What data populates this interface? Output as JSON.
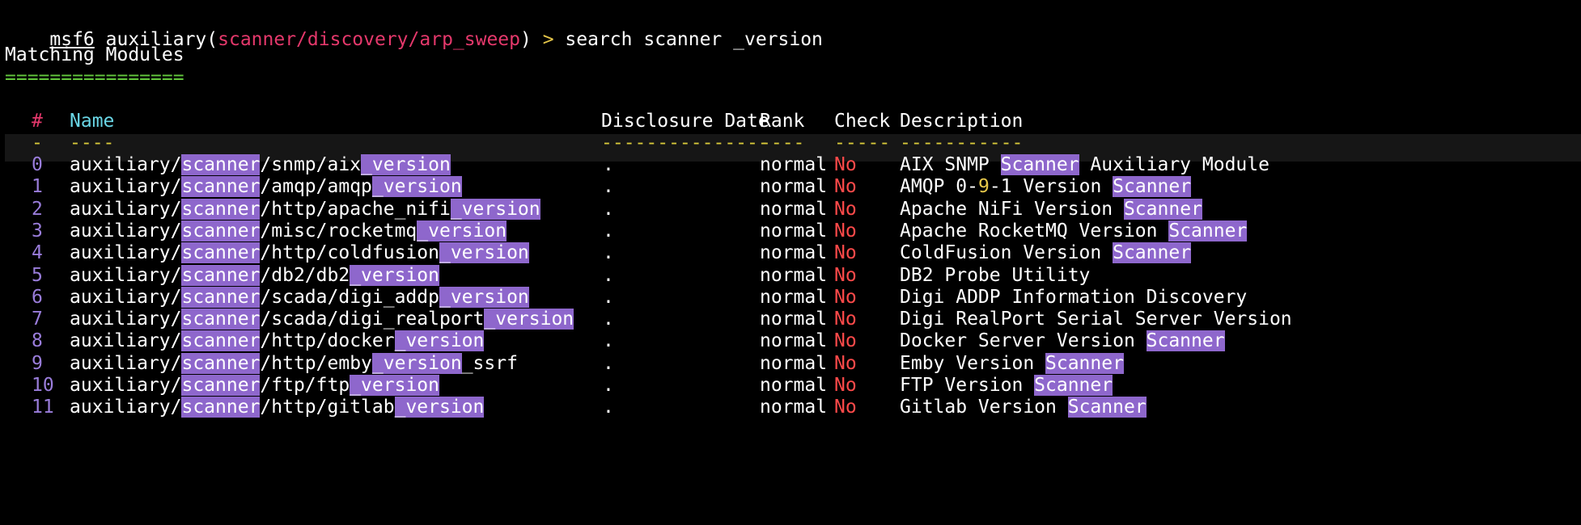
{
  "prompt": {
    "msf": "msf6",
    "keyword": "auxiliary",
    "module": "scanner/discovery/arp_sweep",
    "arrow": ">",
    "command": "search scanner _version"
  },
  "section": {
    "title": "Matching Modules",
    "underline": "================"
  },
  "table": {
    "headers": {
      "num": "#",
      "name": "Name",
      "date": "Disclosure Date",
      "rank": "Rank",
      "check": "Check",
      "desc": "Description"
    },
    "dashes": {
      "num": "-",
      "name": "----",
      "date": "---------------",
      "rank": "----",
      "check": "-----",
      "desc": "-----------"
    },
    "rows": [
      {
        "idx": "0",
        "name_pre": "auxiliary/",
        "name_hl1": "scanner",
        "name_mid": "/snmp/aix",
        "name_hl2": "_version",
        "name_post": "",
        "date": ".",
        "rank": "normal",
        "check": "No",
        "desc_pre": "AIX SNMP ",
        "desc_hl": "Scanner",
        "desc_post": " Auxiliary Module"
      },
      {
        "idx": "1",
        "name_pre": "auxiliary/",
        "name_hl1": "scanner",
        "name_mid": "/amqp/amqp",
        "name_hl2": "_version",
        "name_post": "",
        "date": ".",
        "rank": "normal",
        "check": "No",
        "desc_pre": "AMQP 0-9-1 Version ",
        "desc_hl": "Scanner",
        "desc_post": ""
      },
      {
        "idx": "2",
        "name_pre": "auxiliary/",
        "name_hl1": "scanner",
        "name_mid": "/http/apache_nifi",
        "name_hl2": "_version",
        "name_post": "",
        "date": ".",
        "rank": "normal",
        "check": "No",
        "desc_pre": "Apache NiFi Version ",
        "desc_hl": "Scanner",
        "desc_post": ""
      },
      {
        "idx": "3",
        "name_pre": "auxiliary/",
        "name_hl1": "scanner",
        "name_mid": "/misc/rocketmq",
        "name_hl2": "_version",
        "name_post": "",
        "date": ".",
        "rank": "normal",
        "check": "No",
        "desc_pre": "Apache RocketMQ Version ",
        "desc_hl": "Scanner",
        "desc_post": ""
      },
      {
        "idx": "4",
        "name_pre": "auxiliary/",
        "name_hl1": "scanner",
        "name_mid": "/http/coldfusion",
        "name_hl2": "_version",
        "name_post": "",
        "date": ".",
        "rank": "normal",
        "check": "No",
        "desc_pre": "ColdFusion Version ",
        "desc_hl": "Scanner",
        "desc_post": ""
      },
      {
        "idx": "5",
        "name_pre": "auxiliary/",
        "name_hl1": "scanner",
        "name_mid": "/db2/db2",
        "name_hl2": "_version",
        "name_post": "",
        "date": ".",
        "rank": "normal",
        "check": "No",
        "desc_pre": "DB2 Probe Utility",
        "desc_hl": "",
        "desc_post": ""
      },
      {
        "idx": "6",
        "name_pre": "auxiliary/",
        "name_hl1": "scanner",
        "name_mid": "/scada/digi_addp",
        "name_hl2": "_version",
        "name_post": "",
        "date": ".",
        "rank": "normal",
        "check": "No",
        "desc_pre": "Digi ADDP Information Discovery",
        "desc_hl": "",
        "desc_post": ""
      },
      {
        "idx": "7",
        "name_pre": "auxiliary/",
        "name_hl1": "scanner",
        "name_mid": "/scada/digi_realport",
        "name_hl2": "_version",
        "name_post": "",
        "date": ".",
        "rank": "normal",
        "check": "No",
        "desc_pre": "Digi RealPort Serial Server Version",
        "desc_hl": "",
        "desc_post": ""
      },
      {
        "idx": "8",
        "name_pre": "auxiliary/",
        "name_hl1": "scanner",
        "name_mid": "/http/docker",
        "name_hl2": "_version",
        "name_post": "",
        "date": ".",
        "rank": "normal",
        "check": "No",
        "desc_pre": "Docker Server Version ",
        "desc_hl": "Scanner",
        "desc_post": ""
      },
      {
        "idx": "9",
        "name_pre": "auxiliary/",
        "name_hl1": "scanner",
        "name_mid": "/http/emby",
        "name_hl2": "_version",
        "name_post": "_ssrf",
        "date": ".",
        "rank": "normal",
        "check": "No",
        "desc_pre": "Emby Version ",
        "desc_hl": "Scanner",
        "desc_post": ""
      },
      {
        "idx": "10",
        "name_pre": "auxiliary/",
        "name_hl1": "scanner",
        "name_mid": "/ftp/ftp",
        "name_hl2": "_version",
        "name_post": "",
        "date": ".",
        "rank": "normal",
        "check": "No",
        "desc_pre": "FTP Version ",
        "desc_hl": "Scanner",
        "desc_post": ""
      },
      {
        "idx": "11",
        "name_pre": "auxiliary/",
        "name_hl1": "scanner",
        "name_mid": "/http/gitlab",
        "name_hl2": "_version",
        "name_post": "",
        "date": ".",
        "rank": "normal",
        "check": "No",
        "desc_pre": "Gitlab Version ",
        "desc_hl": "Scanner",
        "desc_post": ""
      }
    ]
  }
}
